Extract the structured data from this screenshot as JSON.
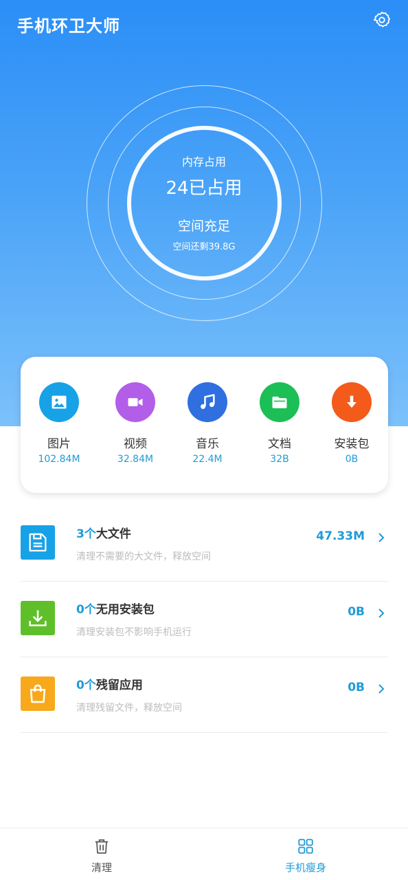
{
  "header": {
    "app_title": "手机环卫大师",
    "settings_icon": "gear-icon"
  },
  "memory": {
    "label": "内存占用",
    "value": "24已占用",
    "status": "空间充足",
    "remaining": "空间还剩39.8G"
  },
  "categories": [
    {
      "name": "图片",
      "size": "102.84M",
      "icon": "image-icon",
      "color": "#17a2e8"
    },
    {
      "name": "视频",
      "size": "32.84M",
      "icon": "video-camera-icon",
      "color": "#b35ee8"
    },
    {
      "name": "音乐",
      "size": "22.4M",
      "icon": "music-note-icon",
      "color": "#2f6fe0"
    },
    {
      "name": "文档",
      "size": "32B",
      "icon": "folder-icon",
      "color": "#1bbf55"
    },
    {
      "name": "安装包",
      "size": "0B",
      "icon": "download-arrow-icon",
      "color": "#f45a1a"
    }
  ],
  "clean_items": [
    {
      "count": "3个",
      "title": "大文件",
      "desc": "清理不需要的大文件，释放空间",
      "size": "47.33M",
      "icon": "floppy-disk-icon",
      "color": "#17a2e8"
    },
    {
      "count": "0个",
      "title": "无用安装包",
      "desc": "清理安装包不影响手机运行",
      "size": "0B",
      "icon": "download-tray-icon",
      "color": "#5fbf2a"
    },
    {
      "count": "0个",
      "title": "残留应用",
      "desc": "清理残留文件，释放空间",
      "size": "0B",
      "icon": "shopping-bag-icon",
      "color": "#f7a81b"
    }
  ],
  "bottom_nav": {
    "tabs": [
      {
        "label": "清理",
        "icon": "trash-can-icon",
        "active": false
      },
      {
        "label": "手机瘦身",
        "icon": "grid-apps-icon",
        "active": true
      }
    ],
    "active_color": "#1f9bd6",
    "inactive_color": "#555555"
  }
}
